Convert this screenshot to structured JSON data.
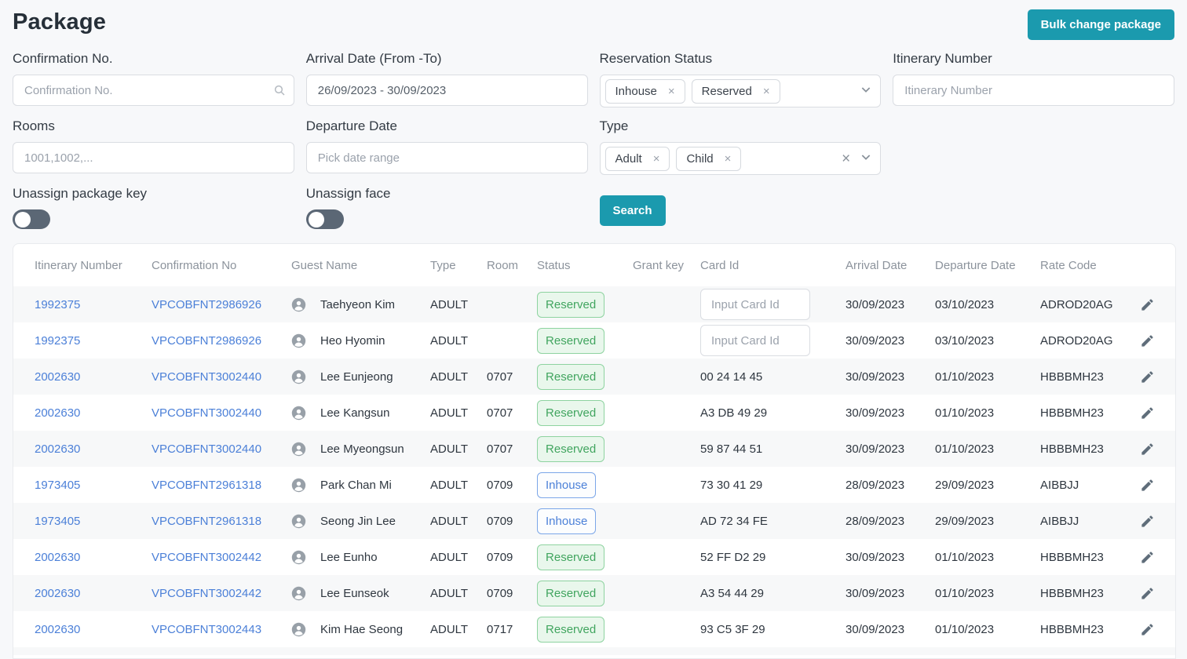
{
  "header": {
    "title": "Package",
    "bulk_button": "Bulk change package"
  },
  "filters": {
    "confirmation_no": {
      "label": "Confirmation No.",
      "placeholder": "Confirmation No."
    },
    "arrival_date": {
      "label": "Arrival Date (From -To)",
      "value": "26/09/2023 - 30/09/2023"
    },
    "reservation_status": {
      "label": "Reservation Status",
      "chips": [
        "Inhouse",
        "Reserved"
      ]
    },
    "itinerary_number": {
      "label": "Itinerary Number",
      "placeholder": "Itinerary Number"
    },
    "rooms": {
      "label": "Rooms",
      "placeholder": "1001,1002,..."
    },
    "departure_date": {
      "label": "Departure Date",
      "placeholder": "Pick date range"
    },
    "type": {
      "label": "Type",
      "chips": [
        "Adult",
        "Child"
      ]
    },
    "unassign_package_key": {
      "label": "Unassign package key",
      "state": "off"
    },
    "unassign_face": {
      "label": "Unassign face",
      "state": "off"
    },
    "search_button": "Search"
  },
  "icons": {
    "chip_remove": "×",
    "clear": "×"
  },
  "colors": {
    "accent_teal": "#1b9aae",
    "link_blue": "#4c80d8",
    "reserved_green": "#41a55f",
    "inhouse_blue": "#4b80d8"
  },
  "table": {
    "columns": [
      "Itinerary Number",
      "Confirmation No",
      "Guest Name",
      "Type",
      "Room",
      "Status",
      "Grant key",
      "Card Id",
      "Arrival Date",
      "Departure Date",
      "Rate Code"
    ],
    "card_id_placeholder": "Input Card Id",
    "rows": [
      {
        "itinerary": "1992375",
        "confirmation": "VPCOBFNT2986926",
        "has_face_icon": false,
        "guest": "Taehyeon Kim",
        "type": "ADULT",
        "room": "",
        "status": "Reserved",
        "card_id": "",
        "card_id_input": true,
        "arrival": "30/09/2023",
        "departure": "03/10/2023",
        "rate_code": "ADROD20AG"
      },
      {
        "itinerary": "1992375",
        "confirmation": "VPCOBFNT2986926",
        "has_face_icon": false,
        "guest": "Heo Hyomin",
        "type": "ADULT",
        "room": "",
        "status": "Reserved",
        "card_id": "",
        "card_id_input": true,
        "arrival": "30/09/2023",
        "departure": "03/10/2023",
        "rate_code": "ADROD20AG"
      },
      {
        "itinerary": "2002630",
        "confirmation": "VPCOBFNT3002440",
        "has_face_icon": false,
        "guest": "Lee Eunjeong",
        "type": "ADULT",
        "room": "0707",
        "status": "Reserved",
        "card_id": "00 24 14 45",
        "card_id_input": false,
        "arrival": "30/09/2023",
        "departure": "01/10/2023",
        "rate_code": "HBBBMH23"
      },
      {
        "itinerary": "2002630",
        "confirmation": "VPCOBFNT3002440",
        "has_face_icon": false,
        "guest": "Lee Kangsun",
        "type": "ADULT",
        "room": "0707",
        "status": "Reserved",
        "card_id": "A3 DB 49 29",
        "card_id_input": false,
        "arrival": "30/09/2023",
        "departure": "01/10/2023",
        "rate_code": "HBBBMH23"
      },
      {
        "itinerary": "2002630",
        "confirmation": "VPCOBFNT3002440",
        "has_face_icon": false,
        "guest": "Lee Myeongsun",
        "type": "ADULT",
        "room": "0707",
        "status": "Reserved",
        "card_id": "59 87 44 51",
        "card_id_input": false,
        "arrival": "30/09/2023",
        "departure": "01/10/2023",
        "rate_code": "HBBBMH23"
      },
      {
        "itinerary": "1973405",
        "confirmation": "VPCOBFNT2961318",
        "has_face_icon": true,
        "guest": "Park Chan Mi",
        "type": "ADULT",
        "room": "0709",
        "status": "Inhouse",
        "card_id": "73 30 41 29",
        "card_id_input": false,
        "arrival": "28/09/2023",
        "departure": "29/09/2023",
        "rate_code": "AIBBJJ"
      },
      {
        "itinerary": "1973405",
        "confirmation": "VPCOBFNT2961318",
        "has_face_icon": true,
        "guest": "Seong Jin Lee",
        "type": "ADULT",
        "room": "0709",
        "status": "Inhouse",
        "card_id": "AD 72 34 FE",
        "card_id_input": false,
        "arrival": "28/09/2023",
        "departure": "29/09/2023",
        "rate_code": "AIBBJJ"
      },
      {
        "itinerary": "2002630",
        "confirmation": "VPCOBFNT3002442",
        "has_face_icon": false,
        "guest": "Lee Eunho",
        "type": "ADULT",
        "room": "0709",
        "status": "Reserved",
        "card_id": "52 FF D2 29",
        "card_id_input": false,
        "arrival": "30/09/2023",
        "departure": "01/10/2023",
        "rate_code": "HBBBMH23"
      },
      {
        "itinerary": "2002630",
        "confirmation": "VPCOBFNT3002442",
        "has_face_icon": false,
        "guest": "Lee Eunseok",
        "type": "ADULT",
        "room": "0709",
        "status": "Reserved",
        "card_id": "A3 54 44 29",
        "card_id_input": false,
        "arrival": "30/09/2023",
        "departure": "01/10/2023",
        "rate_code": "HBBBMH23"
      },
      {
        "itinerary": "2002630",
        "confirmation": "VPCOBFNT3002443",
        "has_face_icon": false,
        "guest": "Kim Hae Seong",
        "type": "ADULT",
        "room": "0717",
        "status": "Reserved",
        "card_id": "93 C5 3F 29",
        "card_id_input": false,
        "arrival": "30/09/2023",
        "departure": "01/10/2023",
        "rate_code": "HBBBMH23"
      }
    ]
  }
}
